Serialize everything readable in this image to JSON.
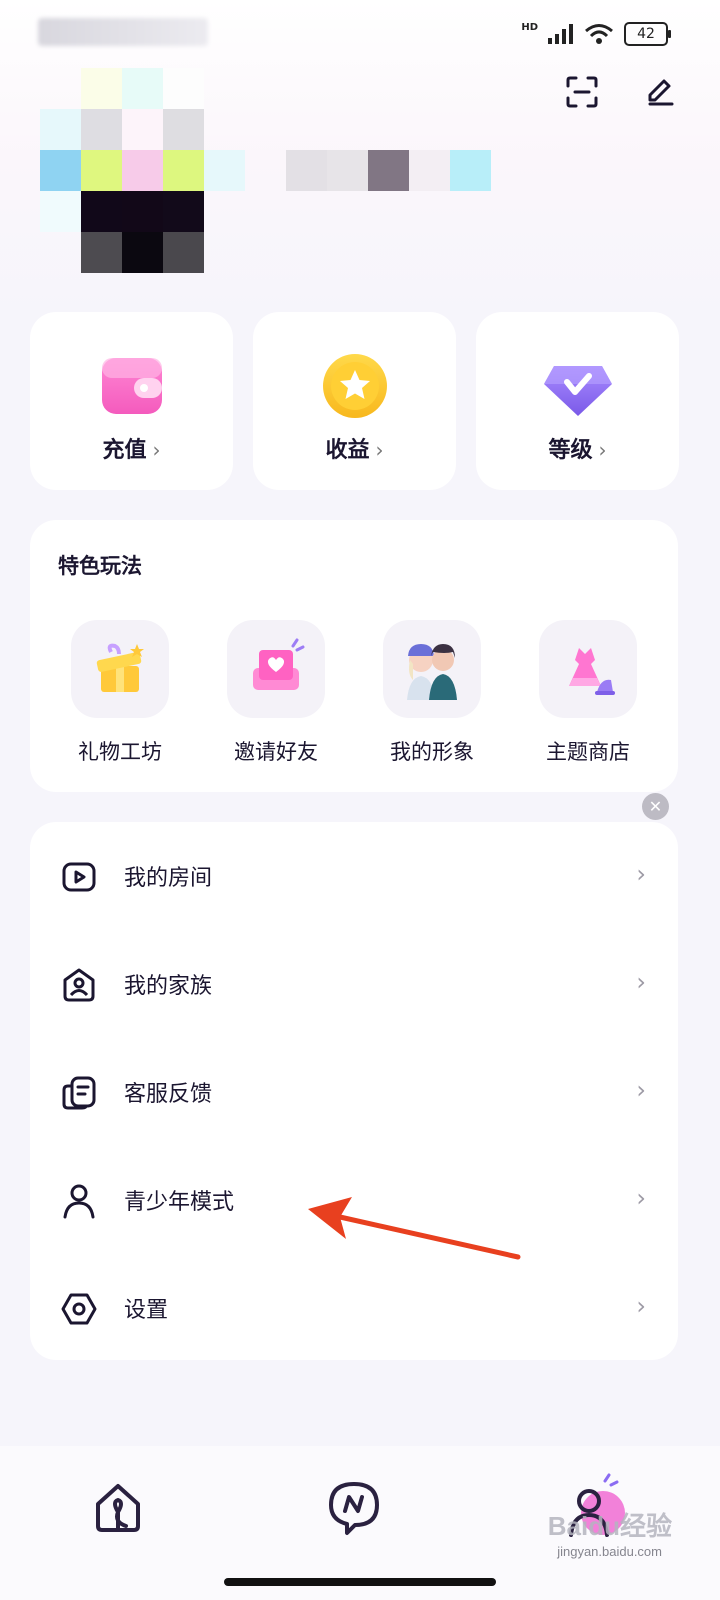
{
  "status_bar": {
    "network_label": "HD",
    "battery": "42"
  },
  "wallet": [
    {
      "label": "充值",
      "icon": "wallet-icon"
    },
    {
      "label": "收益",
      "icon": "star-coin-icon"
    },
    {
      "label": "等级",
      "icon": "diamond-badge-icon"
    }
  ],
  "features": {
    "title": "特色玩法",
    "items": [
      {
        "label": "礼物工坊",
        "icon": "gift-box-icon"
      },
      {
        "label": "邀请好友",
        "icon": "invite-heart-icon"
      },
      {
        "label": "我的形象",
        "icon": "avatar-couple-icon"
      },
      {
        "label": "主题商店",
        "icon": "dress-shop-icon"
      }
    ]
  },
  "menu": [
    {
      "label": "我的房间",
      "icon": "room-icon"
    },
    {
      "label": "我的家族",
      "icon": "family-icon"
    },
    {
      "label": "客服反馈",
      "icon": "feedback-icon"
    },
    {
      "label": "青少年模式",
      "icon": "person-icon"
    },
    {
      "label": "设置",
      "icon": "settings-icon"
    }
  ],
  "bottom_nav": [
    {
      "icon": "home-icon"
    },
    {
      "icon": "message-icon"
    },
    {
      "icon": "profile-icon"
    }
  ],
  "watermark": {
    "brand": "Baidu经验",
    "url": "jingyan.baidu.com"
  },
  "colors": {
    "accent_pink": "#f06bd2",
    "accent_purple": "#8b6cf2",
    "annotation_red": "#e8401f"
  }
}
